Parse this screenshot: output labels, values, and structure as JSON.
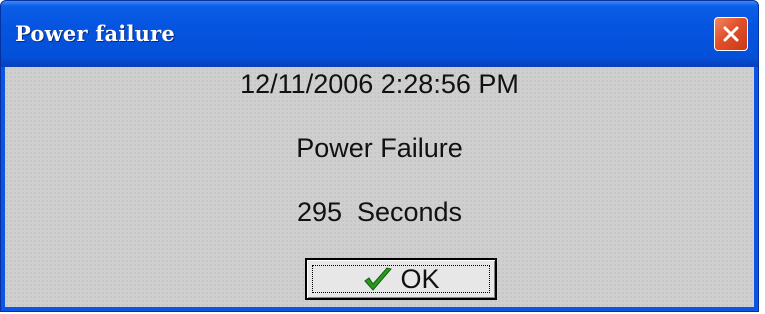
{
  "window": {
    "title": "Power failure",
    "close_icon": "close-x-icon"
  },
  "message": {
    "timestamp": "12/11/2006 2:28:56 PM",
    "event": "Power Failure",
    "duration": "295  Seconds"
  },
  "buttons": {
    "ok_label": "OK",
    "ok_icon": "checkmark-icon"
  },
  "colors": {
    "titlebar": "#0554e0",
    "close_button": "#e2502a",
    "checkmark": "#2a9a1e",
    "client_background": "#cfcfcf"
  }
}
